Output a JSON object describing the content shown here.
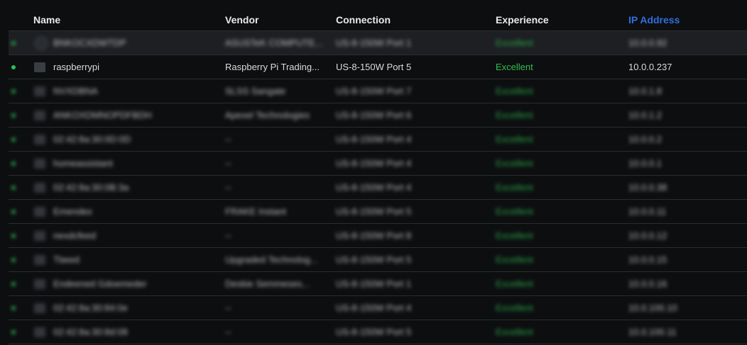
{
  "columns": {
    "name": "Name",
    "vendor": "Vendor",
    "connection": "Connection",
    "experience": "Experience",
    "ip": "IP Address"
  },
  "colors": {
    "accent_blue": "#2f6fe0",
    "online_green": "#2fbf50"
  },
  "rows": [
    {
      "name": "BNKOCXDWTDP",
      "vendor": "ASUSTeK COMPUTE...",
      "connection": "US-8-150W Port 1",
      "experience": "Excellent",
      "ip": "10.0.0.92",
      "blurred": true,
      "highlight": true,
      "icon": "round-device-icon"
    },
    {
      "name": "raspberrypi",
      "vendor": "Raspberry Pi Trading...",
      "connection": "US-8-150W Port 5",
      "experience": "Excellent",
      "ip": "10.0.0.237",
      "blurred": false,
      "highlight": false,
      "icon": "device-icon"
    },
    {
      "name": "NVXDBNA",
      "vendor": "SLSS Sangate",
      "connection": "US-8-150W Port 7",
      "experience": "Excellent",
      "ip": "10.0.1.8",
      "blurred": true,
      "highlight": false,
      "icon": "device-icon"
    },
    {
      "name": "ANKOXDMNOPDFBDH",
      "vendor": "Apexel Technologies",
      "connection": "US-8-150W Port 6",
      "experience": "Excellent",
      "ip": "10.0.1.2",
      "blurred": true,
      "highlight": false,
      "icon": "device-icon"
    },
    {
      "name": "02:42:8a:30:0D:0D",
      "vendor": "--",
      "connection": "US-8-150W Port 4",
      "experience": "Excellent",
      "ip": "10.0.0.2",
      "blurred": true,
      "highlight": false,
      "icon": "device-icon"
    },
    {
      "name": "homeassistant",
      "vendor": "--",
      "connection": "US-8-150W Port 4",
      "experience": "Excellent",
      "ip": "10.0.0.1",
      "blurred": true,
      "highlight": false,
      "icon": "device-icon"
    },
    {
      "name": "02:42:8a:30:0B:3a",
      "vendor": "--",
      "connection": "US-8-150W Port 4",
      "experience": "Excellent",
      "ip": "10.0.0.38",
      "blurred": true,
      "highlight": false,
      "icon": "device-icon"
    },
    {
      "name": "Emendex",
      "vendor": "FRAKE Instant",
      "connection": "US-8-150W Port 5",
      "experience": "Excellent",
      "ip": "10.0.0.11",
      "blurred": true,
      "highlight": false,
      "icon": "device-icon"
    },
    {
      "name": "nexdcfeed",
      "vendor": "--",
      "connection": "US-8-150W Port 8",
      "experience": "Excellent",
      "ip": "10.0.0.12",
      "blurred": true,
      "highlight": false,
      "icon": "device-icon"
    },
    {
      "name": "Tbeed",
      "vendor": "Upgraded Technolog...",
      "connection": "US-8-150W Port 5",
      "experience": "Excellent",
      "ip": "10.0.0.15",
      "blurred": true,
      "highlight": false,
      "icon": "device-icon"
    },
    {
      "name": "Endeened Gdoemeder",
      "vendor": "Deskie Semmeses...",
      "connection": "US-8-150W Port 1",
      "experience": "Excellent",
      "ip": "10.0.0.16",
      "blurred": true,
      "highlight": false,
      "icon": "device-icon"
    },
    {
      "name": "02:42:8a:30:84:0e",
      "vendor": "--",
      "connection": "US-8-150W Port 4",
      "experience": "Excellent",
      "ip": "10.0.100.10",
      "blurred": true,
      "highlight": false,
      "icon": "device-icon"
    },
    {
      "name": "02:42:8a:30:8d:08",
      "vendor": "--",
      "connection": "US-8-150W Port 5",
      "experience": "Excellent",
      "ip": "10.0.100.11",
      "blurred": true,
      "highlight": false,
      "icon": "device-icon"
    }
  ]
}
